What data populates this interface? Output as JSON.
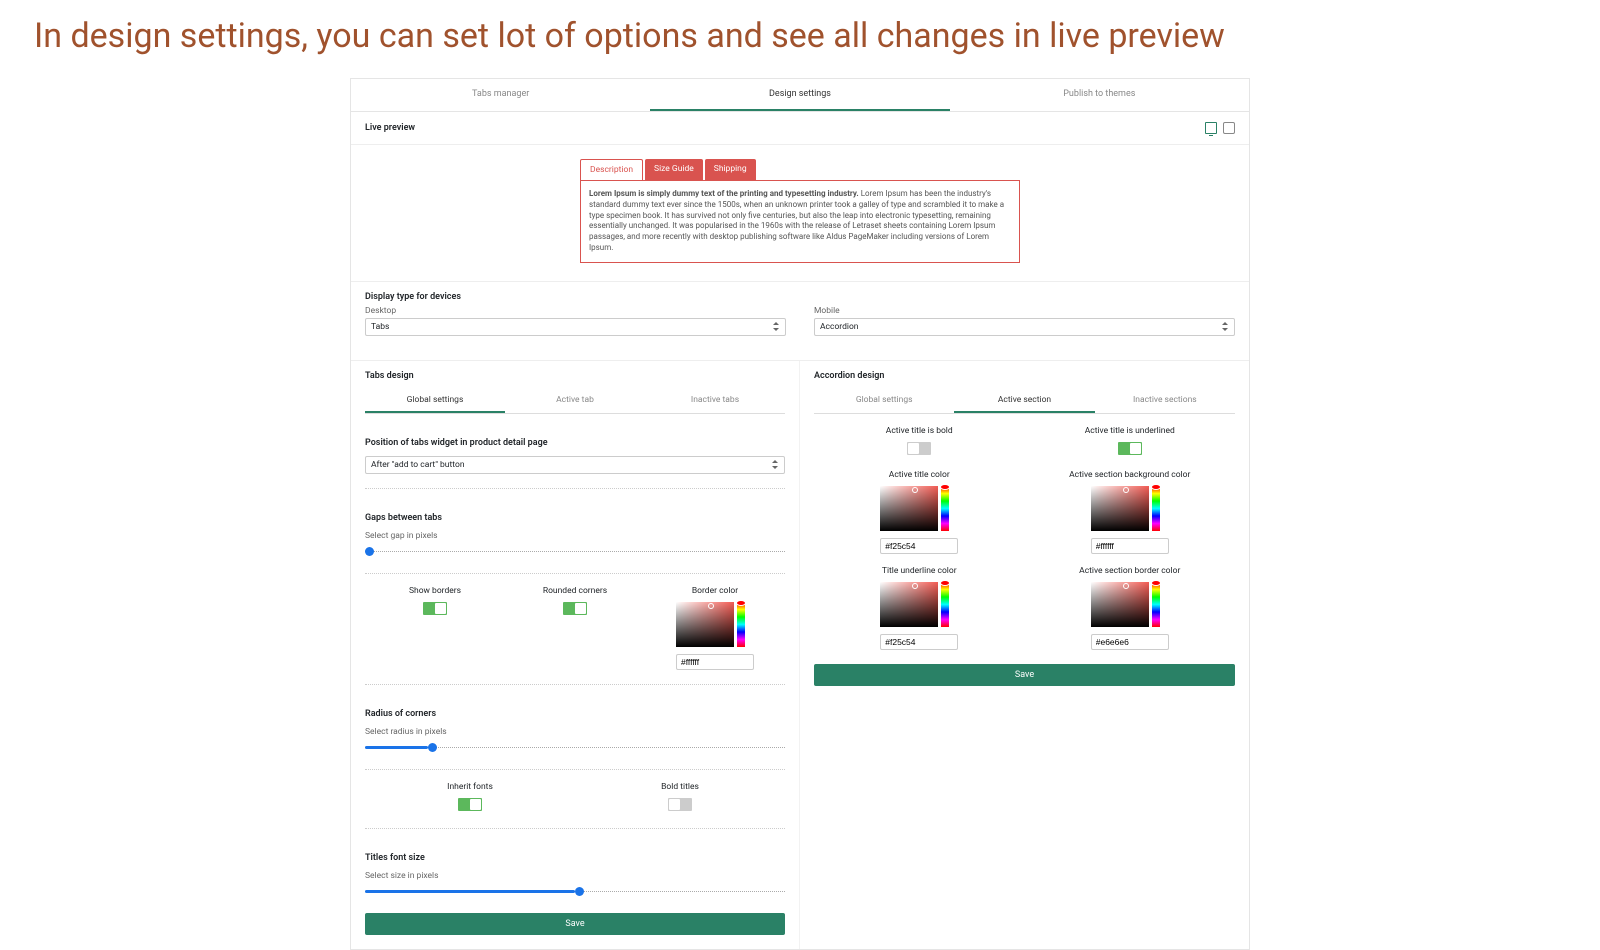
{
  "banner": "In design settings, you can set lot of options and see all changes in live preview",
  "top_tabs": {
    "manager": "Tabs manager",
    "design": "Design settings",
    "publish": "Publish to themes"
  },
  "live_preview_label": "Live preview",
  "preview_tabs": {
    "description": "Description",
    "size_guide": "Size Guide",
    "shipping": "Shipping"
  },
  "preview_body_bold": "Lorem Ipsum is simply dummy text of the printing and typesetting industry.",
  "preview_body_rest": " Lorem Ipsum has been the industry's standard dummy text ever since the 1500s, when an unknown printer took a galley of type and scrambled it to make a type specimen book. It has survived not only five centuries, but also the leap into electronic typesetting, remaining essentially unchanged. It was popularised in the 1960s with the release of Letraset sheets containing Lorem Ipsum passages, and more recently with desktop publishing software like Aldus PageMaker including versions of Lorem Ipsum.",
  "display_type_heading": "Display type for devices",
  "desktop_label": "Desktop",
  "desktop_value": "Tabs",
  "mobile_label": "Mobile",
  "mobile_value": "Accordion",
  "tabs_design_heading": "Tabs design",
  "tabs_design_tabs": {
    "global": "Global settings",
    "active": "Active tab",
    "inactive": "Inactive tabs"
  },
  "position_heading": "Position of tabs widget in product detail page",
  "position_value": "After \"add to cart\" button",
  "gaps_heading": "Gaps between tabs",
  "gaps_sub": "Select gap in pixels",
  "show_borders": "Show borders",
  "rounded_corners": "Rounded corners",
  "border_color_label": "Border color",
  "border_color_value": "#ffffff",
  "radius_heading": "Radius of corners",
  "radius_sub": "Select radius in pixels",
  "inherit_fonts": "Inherit fonts",
  "bold_titles": "Bold titles",
  "titles_font_heading": "Titles font size",
  "titles_font_sub": "Select size in pixels",
  "accordion_heading": "Accordion design",
  "accordion_tabs": {
    "global": "Global settings",
    "active": "Active section",
    "inactive": "Inactive sections"
  },
  "acc": {
    "bold": "Active title is bold",
    "underlined": "Active title is underlined",
    "title_color": "Active title color",
    "title_color_value": "#f25c54",
    "bg_color": "Active section background color",
    "bg_color_value": "#ffffff",
    "underline_color": "Title underline color",
    "underline_color_value": "#f25c54",
    "border_color": "Active section border color",
    "border_color_value": "#e6e6e6"
  },
  "save": "Save"
}
